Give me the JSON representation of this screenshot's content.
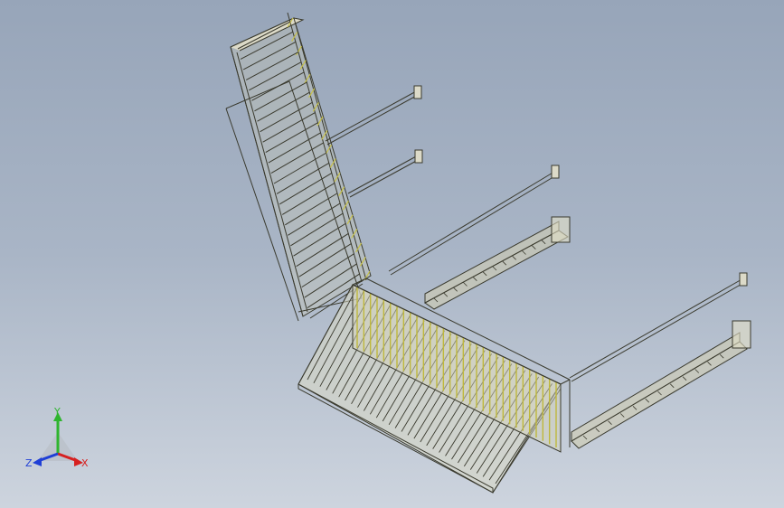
{
  "triad": {
    "x_label": "X",
    "y_label": "Y",
    "z_label": "Z",
    "colors": {
      "x": "#d62020",
      "y": "#2fb52f",
      "z": "#1f3fd6"
    }
  },
  "model_colors": {
    "frame": "#d9d8c4",
    "edge": "#3a3a2e",
    "mesh": "#c8c24a",
    "rod": "#dcdcce"
  }
}
